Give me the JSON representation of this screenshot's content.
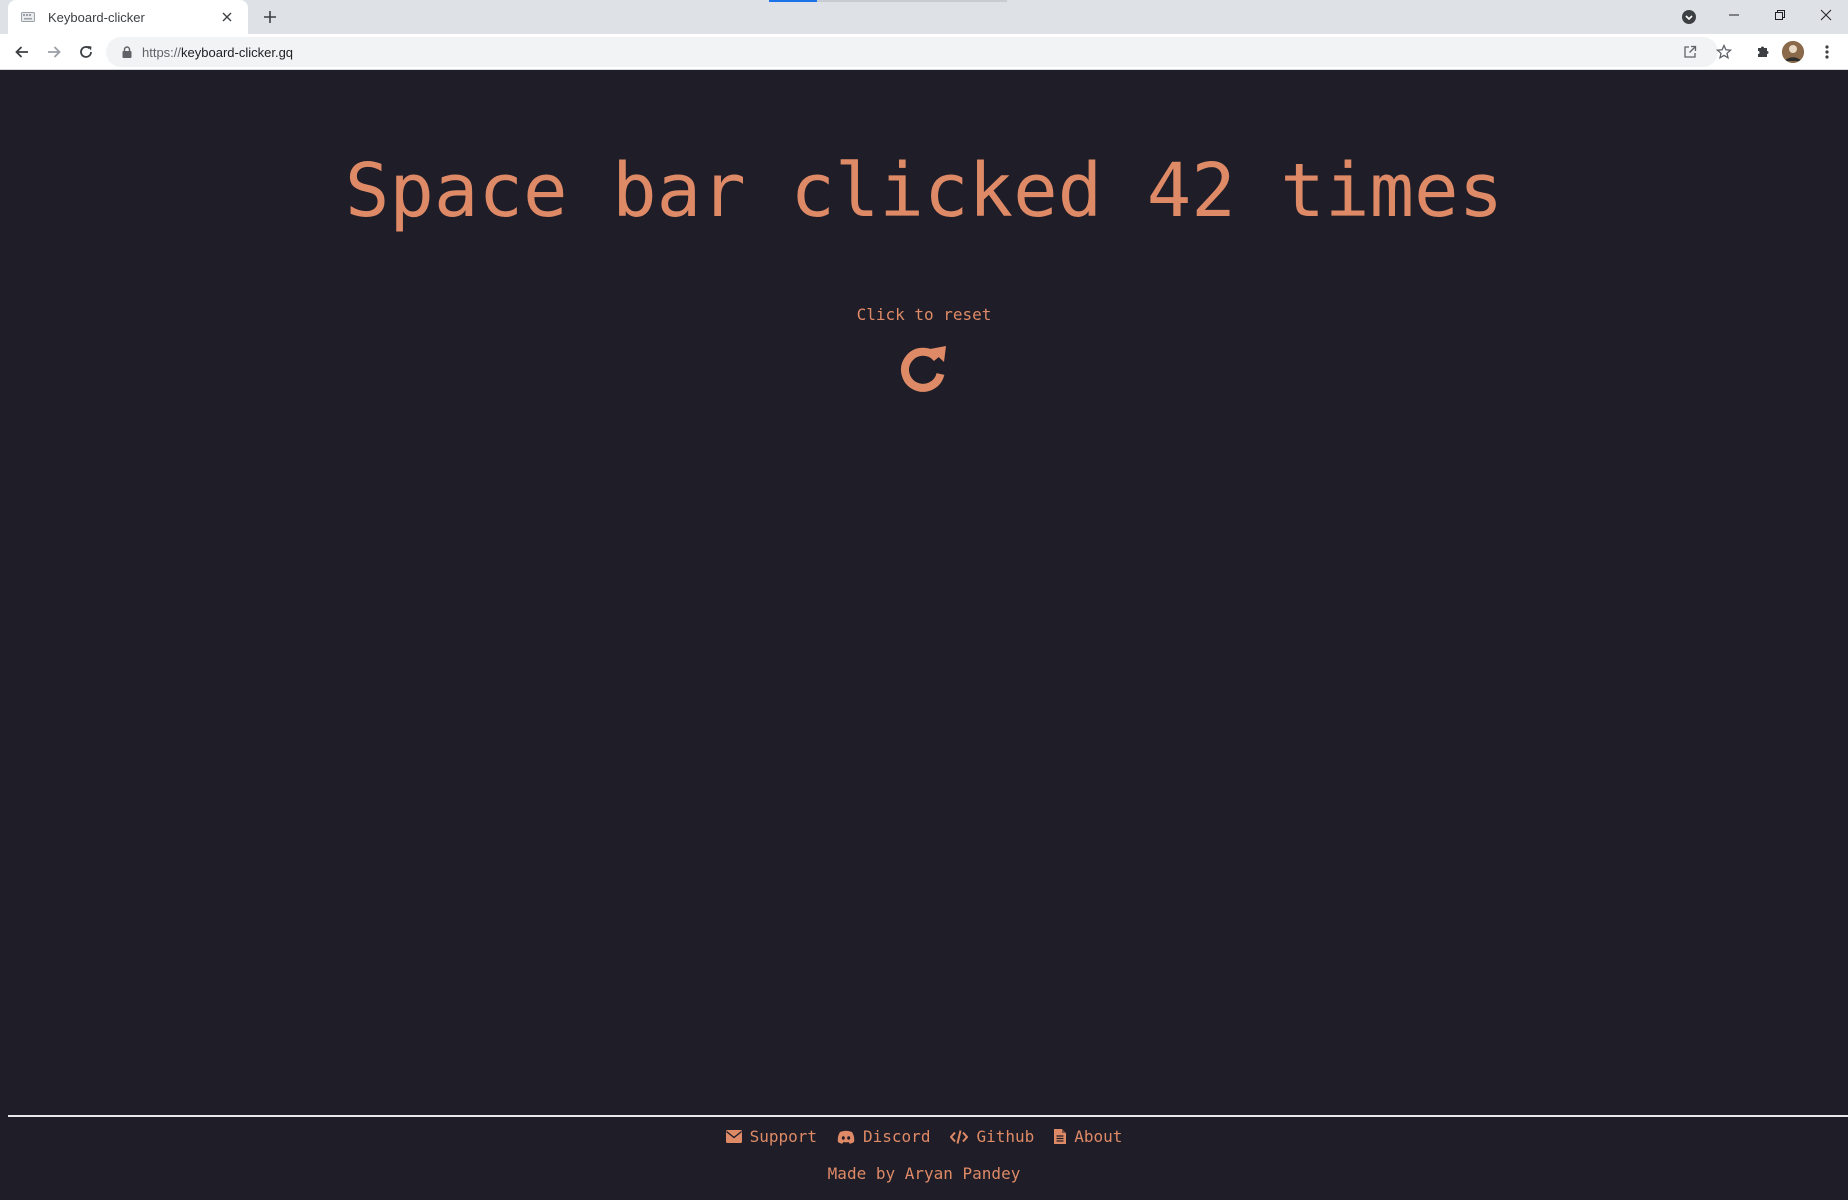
{
  "browser": {
    "tab_title": "Keyboard-clicker",
    "url_scheme": "https://",
    "url_host": "keyboard-clicker.gq"
  },
  "page": {
    "counter_text": "Space bar clicked 42 times",
    "reset_label": "Click to reset"
  },
  "footer": {
    "links": [
      {
        "label": "Support",
        "icon": "envelope-icon"
      },
      {
        "label": "Discord",
        "icon": "discord-icon"
      },
      {
        "label": "Github",
        "icon": "code-icon"
      },
      {
        "label": "About",
        "icon": "document-icon"
      }
    ],
    "credit": "Made by Aryan Pandey"
  },
  "colors": {
    "accent": "#df8a66",
    "background": "#1f1d28"
  }
}
